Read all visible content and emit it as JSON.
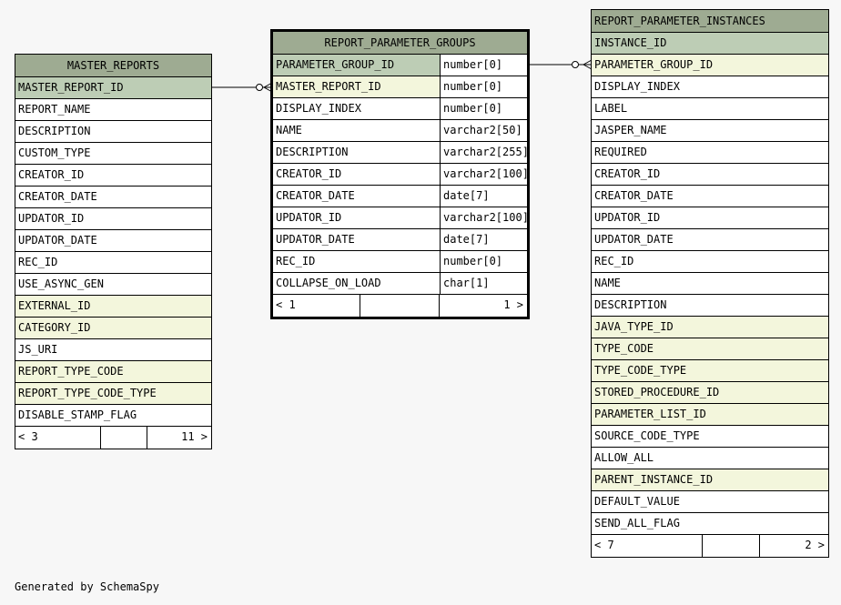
{
  "tables": {
    "master_reports": {
      "title": "MASTER_REPORTS",
      "columns": [
        {
          "name": "MASTER_REPORT_ID",
          "kind": "pk"
        },
        {
          "name": "REPORT_NAME",
          "kind": "plain"
        },
        {
          "name": "DESCRIPTION",
          "kind": "plain"
        },
        {
          "name": "CUSTOM_TYPE",
          "kind": "plain"
        },
        {
          "name": "CREATOR_ID",
          "kind": "plain"
        },
        {
          "name": "CREATOR_DATE",
          "kind": "plain"
        },
        {
          "name": "UPDATOR_ID",
          "kind": "plain"
        },
        {
          "name": "UPDATOR_DATE",
          "kind": "plain"
        },
        {
          "name": "REC_ID",
          "kind": "plain"
        },
        {
          "name": "USE_ASYNC_GEN",
          "kind": "plain"
        },
        {
          "name": "EXTERNAL_ID",
          "kind": "fk"
        },
        {
          "name": "CATEGORY_ID",
          "kind": "fk"
        },
        {
          "name": "JS_URI",
          "kind": "plain"
        },
        {
          "name": "REPORT_TYPE_CODE",
          "kind": "fk"
        },
        {
          "name": "REPORT_TYPE_CODE_TYPE",
          "kind": "fk"
        },
        {
          "name": "DISABLE_STAMP_FLAG",
          "kind": "plain"
        }
      ],
      "footer": {
        "parents": "< 3",
        "children": "11 >"
      }
    },
    "report_parameter_groups": {
      "title": "REPORT_PARAMETER_GROUPS",
      "columns": [
        {
          "name": "PARAMETER_GROUP_ID",
          "type": "number[0]",
          "kind": "pk"
        },
        {
          "name": "MASTER_REPORT_ID",
          "type": "number[0]",
          "kind": "fk"
        },
        {
          "name": "DISPLAY_INDEX",
          "type": "number[0]",
          "kind": "plain"
        },
        {
          "name": "NAME",
          "type": "varchar2[50]",
          "kind": "plain"
        },
        {
          "name": "DESCRIPTION",
          "type": "varchar2[255]",
          "kind": "plain"
        },
        {
          "name": "CREATOR_ID",
          "type": "varchar2[100]",
          "kind": "plain"
        },
        {
          "name": "CREATOR_DATE",
          "type": "date[7]",
          "kind": "plain"
        },
        {
          "name": "UPDATOR_ID",
          "type": "varchar2[100]",
          "kind": "plain"
        },
        {
          "name": "UPDATOR_DATE",
          "type": "date[7]",
          "kind": "plain"
        },
        {
          "name": "REC_ID",
          "type": "number[0]",
          "kind": "plain"
        },
        {
          "name": "COLLAPSE_ON_LOAD",
          "type": "char[1]",
          "kind": "plain"
        }
      ],
      "footer": {
        "parents": "< 1",
        "children": "1 >"
      }
    },
    "report_parameter_instances": {
      "title": "REPORT_PARAMETER_INSTANCES",
      "columns": [
        {
          "name": "INSTANCE_ID",
          "kind": "pk"
        },
        {
          "name": "PARAMETER_GROUP_ID",
          "kind": "fk"
        },
        {
          "name": "DISPLAY_INDEX",
          "kind": "plain"
        },
        {
          "name": "LABEL",
          "kind": "plain"
        },
        {
          "name": "JASPER_NAME",
          "kind": "plain"
        },
        {
          "name": "REQUIRED",
          "kind": "plain"
        },
        {
          "name": "CREATOR_ID",
          "kind": "plain"
        },
        {
          "name": "CREATOR_DATE",
          "kind": "plain"
        },
        {
          "name": "UPDATOR_ID",
          "kind": "plain"
        },
        {
          "name": "UPDATOR_DATE",
          "kind": "plain"
        },
        {
          "name": "REC_ID",
          "kind": "plain"
        },
        {
          "name": "NAME",
          "kind": "plain"
        },
        {
          "name": "DESCRIPTION",
          "kind": "plain"
        },
        {
          "name": "JAVA_TYPE_ID",
          "kind": "fk"
        },
        {
          "name": "TYPE_CODE",
          "kind": "fk"
        },
        {
          "name": "TYPE_CODE_TYPE",
          "kind": "fk"
        },
        {
          "name": "STORED_PROCEDURE_ID",
          "kind": "fk"
        },
        {
          "name": "PARAMETER_LIST_ID",
          "kind": "fk"
        },
        {
          "name": "SOURCE_CODE_TYPE",
          "kind": "plain"
        },
        {
          "name": "ALLOW_ALL",
          "kind": "plain"
        },
        {
          "name": "PARENT_INSTANCE_ID",
          "kind": "fk"
        },
        {
          "name": "DEFAULT_VALUE",
          "kind": "plain"
        },
        {
          "name": "SEND_ALL_FLAG",
          "kind": "plain"
        }
      ],
      "footer": {
        "parents": "< 7",
        "children": "2 >"
      }
    }
  },
  "credit": "Generated by SchemaSpy"
}
